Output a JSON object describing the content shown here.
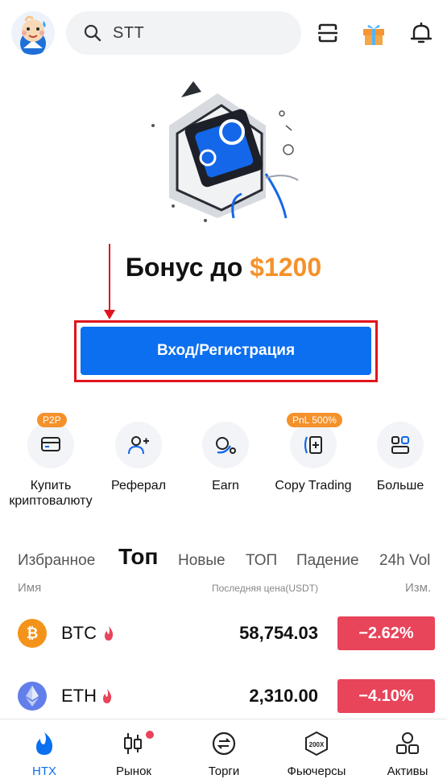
{
  "header": {
    "search_text": "STT",
    "icons": [
      "avatar",
      "search-icon",
      "scan-icon",
      "gift-icon",
      "bell-icon"
    ]
  },
  "hero": {
    "bonus_prefix": "Бонус до",
    "bonus_amount": "$1200",
    "login_button": "Вход/Регистрация"
  },
  "actions": [
    {
      "label": "Купить криптовалюту",
      "tag": "P2P",
      "icon": "card-icon"
    },
    {
      "label": "Реферал",
      "tag": "",
      "icon": "add-user-icon"
    },
    {
      "label": "Earn",
      "tag": "",
      "icon": "earn-icon"
    },
    {
      "label": "Copy Trading",
      "tag": "PnL 500%",
      "icon": "copy-trading-icon"
    },
    {
      "label": "Больше",
      "tag": "",
      "icon": "grid-icon"
    }
  ],
  "market": {
    "tabs": [
      "Избранное",
      "Топ",
      "Новые",
      "ТОП",
      "Падение",
      "24h Vol"
    ],
    "active_tab": "Топ",
    "col_name": "Имя",
    "col_price": "Последняя цена(USDT)",
    "col_change": "Изм.",
    "rows": [
      {
        "symbol": "BTC",
        "price": "58,754.03",
        "change": "−2.62%"
      },
      {
        "symbol": "ETH",
        "price": "2,310.00",
        "change": "−4.10%"
      }
    ]
  },
  "nav": [
    {
      "label": "HTX",
      "active": true
    },
    {
      "label": "Рынок",
      "active": false
    },
    {
      "label": "Торги",
      "active": false
    },
    {
      "label": "Фьючерсы",
      "active": false
    },
    {
      "label": "Активы",
      "active": false
    }
  ],
  "colors": {
    "accent": "#0b6ff0",
    "bonus": "#f5912b",
    "negative": "#e8445a",
    "highlight": "#e0141e"
  }
}
